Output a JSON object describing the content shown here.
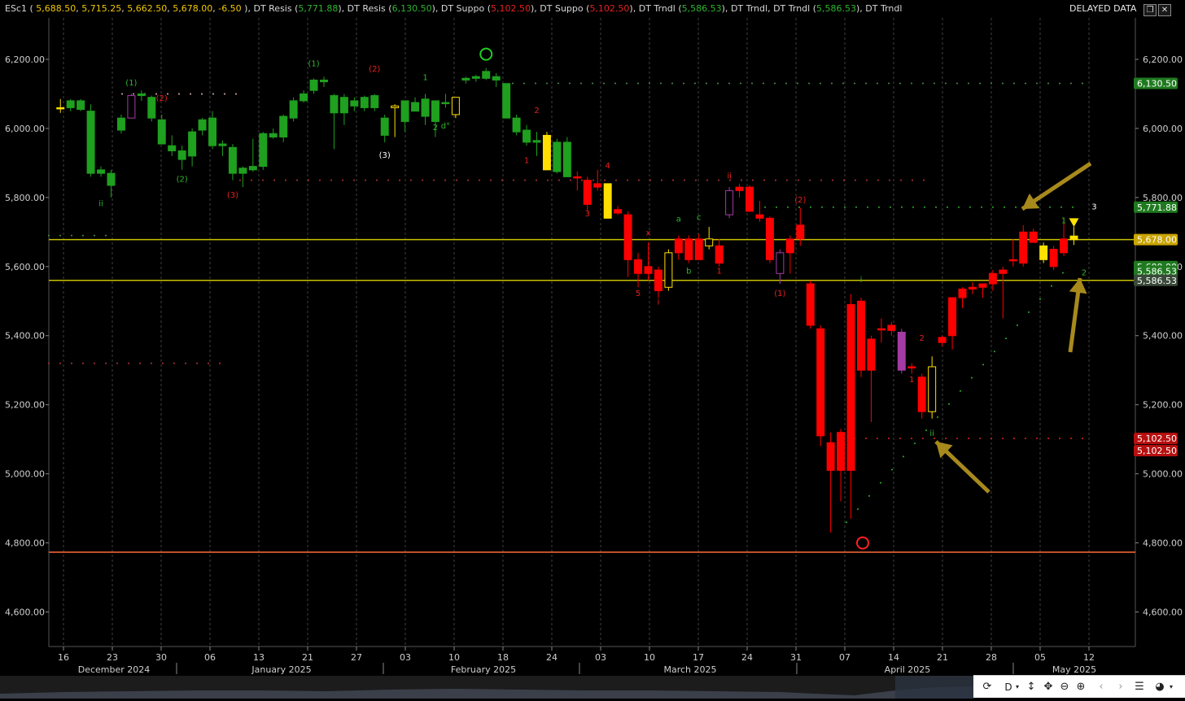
{
  "legend": {
    "symbol": "ESc1",
    "ohlc": [
      "5,688.50",
      "5,715.25",
      "5,662.50",
      "5,678.00",
      "-6.50"
    ],
    "indicators": [
      {
        "name": "DT Resis",
        "value": "5,771.88",
        "color": "#2fb52f"
      },
      {
        "name": "DT Resis",
        "value": "6,130.50",
        "color": "#2fb52f"
      },
      {
        "name": "DT Suppo",
        "value": "5,102.50",
        "color": "#e82020"
      },
      {
        "name": "DT Suppo",
        "value": "5,102.50",
        "color": "#e82020"
      },
      {
        "name": "DT Trndl",
        "value": "5,586.53",
        "color": "#2fb52f"
      },
      {
        "name": "DT Trndl",
        "value": "",
        "color": "#2fb52f"
      },
      {
        "name": "DT Trndl",
        "value": "5,586.53",
        "color": "#2fb52f"
      },
      {
        "name": "DT Trndl",
        "value": "",
        "color": "#2fb52f"
      }
    ]
  },
  "status": {
    "delayed": "DELAYED DATA"
  },
  "toolbar": {
    "refresh_icon": "refresh-icon",
    "interval": "D",
    "icons": [
      "move-vertical-icon",
      "pan-icon",
      "zoom-out-icon",
      "zoom-in-icon",
      "chevron-left-icon",
      "chevron-right-icon",
      "list-icon",
      "palette-icon"
    ]
  },
  "chart_data": {
    "type": "candlestick",
    "title": "",
    "ylim": [
      4500,
      6320
    ],
    "y_ticks": [
      {
        "v": 4600,
        "label": "4,600.00"
      },
      {
        "v": 4800,
        "label": "4,800.00"
      },
      {
        "v": 5000,
        "label": "5,000.00"
      },
      {
        "v": 5200,
        "label": "5,200.00"
      },
      {
        "v": 5400,
        "label": "5,400.00"
      },
      {
        "v": 5600,
        "label": "5,600.00"
      },
      {
        "v": 5800,
        "label": "5,800.00"
      },
      {
        "v": 6000,
        "label": "6,000.00"
      },
      {
        "v": 6200,
        "label": "6,200.00"
      }
    ],
    "x_ticks": [
      "16",
      "23",
      "30",
      "06",
      "13",
      "21",
      "27",
      "03",
      "10",
      "18",
      "24",
      "03",
      "10",
      "17",
      "24",
      "31",
      "07",
      "14",
      "21",
      "28",
      "05",
      "12"
    ],
    "months": [
      "December 2024",
      "January 2025",
      "February 2025",
      "March 2025",
      "April 2025",
      "May 2025"
    ],
    "right_labels": [
      {
        "v": 6130.5,
        "label": "6,130.50",
        "color": "#1f7a1f"
      },
      {
        "v": 5771.88,
        "label": "5,771.88",
        "color": "#1f7a1f"
      },
      {
        "v": 5678.0,
        "label": "5,678.00",
        "color": "#c9a400"
      },
      {
        "v": 5600.0,
        "label": "5,600.00",
        "color": "#1f7a1f"
      },
      {
        "v": 5586.53,
        "label": "5,586.53",
        "color": "#1f7a1f"
      },
      {
        "v": 5560.0,
        "label": "5,586.53",
        "color": "#3a4a3a"
      },
      {
        "v": 5102.5,
        "label": "5,102.50",
        "color": "#b81010"
      },
      {
        "v": 5067.0,
        "label": "5,102.50",
        "color": "#b81010"
      }
    ],
    "horizontal_lines": [
      {
        "v": 5678.0,
        "color": "#c8c000"
      },
      {
        "v": 5560.0,
        "color": "#c8c000"
      },
      {
        "v": 4773.0,
        "color": "#ff6a3a"
      }
    ],
    "candles": [
      {
        "o": 6060,
        "h": 6085,
        "l": 6045,
        "c": 6060,
        "col": "#ffe000"
      },
      {
        "o": 6060,
        "h": 6085,
        "l": 6050,
        "c": 6080,
        "col": "#1fa01f"
      },
      {
        "o": 6080,
        "h": 6085,
        "l": 6050,
        "c": 6055,
        "col": "#1fa01f"
      },
      {
        "o": 6050,
        "h": 6070,
        "l": 5860,
        "c": 5870,
        "col": "#1fa01f"
      },
      {
        "o": 5880,
        "h": 5890,
        "l": 5860,
        "c": 5870,
        "col": "#1fa01f"
      },
      {
        "o": 5870,
        "h": 5880,
        "l": 5800,
        "c": 5835,
        "col": "#1fa01f"
      },
      {
        "o": 5995,
        "h": 6040,
        "l": 5985,
        "c": 6030,
        "col": "#1fa01f"
      },
      {
        "o": 6030,
        "h": 6100,
        "l": 6030,
        "c": 6095,
        "col": "#a43aa4"
      },
      {
        "o": 6095,
        "h": 6110,
        "l": 6080,
        "c": 6100,
        "col": "#1fa01f"
      },
      {
        "o": 6090,
        "h": 6095,
        "l": 6020,
        "c": 6030,
        "col": "#1fa01f"
      },
      {
        "o": 6025,
        "h": 6040,
        "l": 5970,
        "c": 5955,
        "col": "#1fa01f"
      },
      {
        "o": 5950,
        "h": 5980,
        "l": 5920,
        "c": 5935,
        "col": "#1fa01f"
      },
      {
        "o": 5935,
        "h": 5950,
        "l": 5880,
        "c": 5910,
        "col": "#1fa01f"
      },
      {
        "o": 5920,
        "h": 6000,
        "l": 5890,
        "c": 5990,
        "col": "#1fa01f"
      },
      {
        "o": 5995,
        "h": 6030,
        "l": 5980,
        "c": 6025,
        "col": "#1fa01f"
      },
      {
        "o": 6030,
        "h": 6050,
        "l": 5940,
        "c": 5950,
        "col": "#1fa01f"
      },
      {
        "o": 5950,
        "h": 5965,
        "l": 5920,
        "c": 5955,
        "col": "#1fa01f"
      },
      {
        "o": 5945,
        "h": 5955,
        "l": 5850,
        "c": 5870,
        "col": "#1fa01f"
      },
      {
        "o": 5870,
        "h": 5890,
        "l": 5830,
        "c": 5885,
        "col": "#1fa01f"
      },
      {
        "o": 5880,
        "h": 5970,
        "l": 5875,
        "c": 5890,
        "col": "#1fa01f"
      },
      {
        "o": 5890,
        "h": 5990,
        "l": 5880,
        "c": 5985,
        "col": "#1fa01f"
      },
      {
        "o": 5975,
        "h": 6000,
        "l": 5970,
        "c": 5985,
        "col": "#1fa01f"
      },
      {
        "o": 5975,
        "h": 6040,
        "l": 5960,
        "c": 6035,
        "col": "#1fa01f"
      },
      {
        "o": 6030,
        "h": 6090,
        "l": 6020,
        "c": 6080,
        "col": "#1fa01f"
      },
      {
        "o": 6080,
        "h": 6110,
        "l": 6075,
        "c": 6100,
        "col": "#1fa01f"
      },
      {
        "o": 6110,
        "h": 6145,
        "l": 6100,
        "c": 6140,
        "col": "#1fa01f"
      },
      {
        "o": 6135,
        "h": 6150,
        "l": 6120,
        "c": 6140,
        "col": "#1fa01f"
      },
      {
        "o": 6095,
        "h": 6100,
        "l": 5940,
        "c": 6045,
        "col": "#1fa01f"
      },
      {
        "o": 6045,
        "h": 6100,
        "l": 6010,
        "c": 6090,
        "col": "#1fa01f"
      },
      {
        "o": 6080,
        "h": 6090,
        "l": 6050,
        "c": 6065,
        "col": "#1fa01f"
      },
      {
        "o": 6060,
        "h": 6095,
        "l": 6050,
        "c": 6090,
        "col": "#1fa01f"
      },
      {
        "o": 6060,
        "h": 6100,
        "l": 6050,
        "c": 6095,
        "col": "#1fa01f"
      },
      {
        "o": 6030,
        "h": 6040,
        "l": 5960,
        "c": 5980,
        "col": "#1fa01f"
      },
      {
        "o": 6060,
        "h": 6070,
        "l": 5975,
        "c": 6065,
        "col": "#ffe000"
      },
      {
        "o": 6080,
        "h": 6080,
        "l": 5990,
        "c": 6020,
        "col": "#1fa01f"
      },
      {
        "o": 6050,
        "h": 6090,
        "l": 6050,
        "c": 6075,
        "col": "#1fa01f"
      },
      {
        "o": 6085,
        "h": 6100,
        "l": 6010,
        "c": 6035,
        "col": "#1fa01f"
      },
      {
        "o": 6020,
        "h": 6080,
        "l": 5975,
        "c": 6080,
        "col": "#1fa01f"
      },
      {
        "o": 6075,
        "h": 6100,
        "l": 6060,
        "c": 6075,
        "col": "#1fa01f"
      },
      {
        "o": 6040,
        "h": 6080,
        "l": 6030,
        "c": 6090,
        "col": "#ffe000"
      },
      {
        "o": 6140,
        "h": 6150,
        "l": 6130,
        "c": 6145,
        "col": "#1fa01f"
      },
      {
        "o": 6145,
        "h": 6155,
        "l": 6135,
        "c": 6150,
        "col": "#1fa01f"
      },
      {
        "o": 6165,
        "h": 6175,
        "l": 6140,
        "c": 6145,
        "col": "#1fa01f"
      },
      {
        "o": 6150,
        "h": 6160,
        "l": 6120,
        "c": 6140,
        "col": "#1fa01f"
      },
      {
        "o": 6130,
        "h": 6130,
        "l": 6030,
        "c": 6030,
        "col": "#1fa01f"
      },
      {
        "o": 6030,
        "h": 6040,
        "l": 5980,
        "c": 5990,
        "col": "#1fa01f"
      },
      {
        "o": 5995,
        "h": 6010,
        "l": 5950,
        "c": 5960,
        "col": "#1fa01f"
      },
      {
        "o": 5965,
        "h": 5990,
        "l": 5920,
        "c": 5960,
        "col": "#1fa01f"
      },
      {
        "o": 5980,
        "h": 5990,
        "l": 5880,
        "c": 5880,
        "col": "#ffe000"
      },
      {
        "o": 5960,
        "h": 5970,
        "l": 5870,
        "c": 5875,
        "col": "#1fa01f"
      },
      {
        "o": 5960,
        "h": 5975,
        "l": 5860,
        "c": 5860,
        "col": "#1fa01f"
      },
      {
        "o": 5860,
        "h": 5875,
        "l": 5820,
        "c": 5860,
        "col": "#ff0000"
      },
      {
        "o": 5850,
        "h": 5860,
        "l": 5760,
        "c": 5780,
        "col": "#ff0000"
      },
      {
        "o": 5840,
        "h": 5880,
        "l": 5820,
        "c": 5830,
        "col": "#ff0000"
      },
      {
        "o": 5840,
        "h": 5840,
        "l": 5740,
        "c": 5740,
        "col": "#ffe000"
      },
      {
        "o": 5765,
        "h": 5775,
        "l": 5750,
        "c": 5755,
        "col": "#ff0000"
      },
      {
        "o": 5750,
        "h": 5760,
        "l": 5570,
        "c": 5620,
        "col": "#ff0000"
      },
      {
        "o": 5620,
        "h": 5640,
        "l": 5540,
        "c": 5580,
        "col": "#ff0000"
      },
      {
        "o": 5600,
        "h": 5670,
        "l": 5560,
        "c": 5580,
        "col": "#ff0000"
      },
      {
        "o": 5590,
        "h": 5600,
        "l": 5510,
        "c": 5530,
        "col": "#ff0000"
      },
      {
        "o": 5540,
        "h": 5650,
        "l": 5530,
        "c": 5640,
        "col": "#ffe000"
      },
      {
        "o": 5640,
        "h": 5690,
        "l": 5620,
        "c": 5680,
        "col": "#ff0000"
      },
      {
        "o": 5680,
        "h": 5690,
        "l": 5610,
        "c": 5620,
        "col": "#ff0000"
      },
      {
        "o": 5680,
        "h": 5695,
        "l": 5620,
        "c": 5620,
        "col": "#ff0000"
      },
      {
        "o": 5660,
        "h": 5715,
        "l": 5650,
        "c": 5680,
        "col": "#ffe000"
      },
      {
        "o": 5660,
        "h": 5680,
        "l": 5600,
        "c": 5610,
        "col": "#ff0000"
      },
      {
        "o": 5750,
        "h": 5830,
        "l": 5740,
        "c": 5820,
        "col": "#a43aa4"
      },
      {
        "o": 5820,
        "h": 5840,
        "l": 5800,
        "c": 5830,
        "col": "#ff0000"
      },
      {
        "o": 5830,
        "h": 5835,
        "l": 5760,
        "c": 5760,
        "col": "#ff0000"
      },
      {
        "o": 5750,
        "h": 5790,
        "l": 5730,
        "c": 5740,
        "col": "#ff0000"
      },
      {
        "o": 5740,
        "h": 5745,
        "l": 5610,
        "c": 5620,
        "col": "#ff0000"
      },
      {
        "o": 5580,
        "h": 5650,
        "l": 5550,
        "c": 5640,
        "col": "#a43aa4"
      },
      {
        "o": 5640,
        "h": 5690,
        "l": 5580,
        "c": 5680,
        "col": "#ff0000"
      },
      {
        "o": 5680,
        "h": 5770,
        "l": 5660,
        "c": 5720,
        "col": "#ff0000"
      },
      {
        "o": 5550,
        "h": 5560,
        "l": 5420,
        "c": 5430,
        "col": "#ff0000"
      },
      {
        "o": 5420,
        "h": 5430,
        "l": 5080,
        "c": 5110,
        "col": "#ff0000"
      },
      {
        "o": 5090,
        "h": 5120,
        "l": 4830,
        "c": 5010,
        "col": "#ff0000"
      },
      {
        "o": 5010,
        "h": 5130,
        "l": 4920,
        "c": 5120,
        "col": "#ff0000"
      },
      {
        "o": 5010,
        "h": 5520,
        "l": 4870,
        "c": 5490,
        "col": "#ff0000"
      },
      {
        "o": 5500,
        "h": 5510,
        "l": 5280,
        "c": 5300,
        "col": "#ff0000"
      },
      {
        "o": 5300,
        "h": 5400,
        "l": 5150,
        "c": 5390,
        "col": "#ff0000"
      },
      {
        "o": 5420,
        "h": 5450,
        "l": 5380,
        "c": 5420,
        "col": "#ff0000"
      },
      {
        "o": 5430,
        "h": 5440,
        "l": 5400,
        "c": 5415,
        "col": "#ff0000"
      },
      {
        "o": 5410,
        "h": 5420,
        "l": 5290,
        "c": 5300,
        "col": "#a43aa4"
      },
      {
        "o": 5310,
        "h": 5320,
        "l": 5290,
        "c": 5310,
        "col": "#ff0000"
      },
      {
        "o": 5280,
        "h": 5290,
        "l": 5160,
        "c": 5180,
        "col": "#ff0000"
      },
      {
        "o": 5180,
        "h": 5340,
        "l": 5160,
        "c": 5310,
        "col": "#ffe000"
      },
      {
        "o": 5380,
        "h": 5400,
        "l": 5370,
        "c": 5395,
        "col": "#ff0000"
      },
      {
        "o": 5400,
        "h": 5470,
        "l": 5360,
        "c": 5510,
        "col": "#ff0000"
      },
      {
        "o": 5510,
        "h": 5540,
        "l": 5480,
        "c": 5535,
        "col": "#ff0000"
      },
      {
        "o": 5535,
        "h": 5555,
        "l": 5520,
        "c": 5540,
        "col": "#ff0000"
      },
      {
        "o": 5540,
        "h": 5550,
        "l": 5510,
        "c": 5550,
        "col": "#ff0000"
      },
      {
        "o": 5550,
        "h": 5590,
        "l": 5530,
        "c": 5580,
        "col": "#ff0000"
      },
      {
        "o": 5580,
        "h": 5600,
        "l": 5450,
        "c": 5590,
        "col": "#ff0000"
      },
      {
        "o": 5620,
        "h": 5680,
        "l": 5600,
        "c": 5620,
        "col": "#ff0000"
      },
      {
        "o": 5610,
        "h": 5720,
        "l": 5600,
        "c": 5700,
        "col": "#ff0000"
      },
      {
        "o": 5700,
        "h": 5710,
        "l": 5670,
        "c": 5670,
        "col": "#ff0000"
      },
      {
        "o": 5660,
        "h": 5670,
        "l": 5610,
        "c": 5620,
        "col": "#ffe000"
      },
      {
        "o": 5600,
        "h": 5660,
        "l": 5590,
        "c": 5650,
        "col": "#ff0000"
      },
      {
        "o": 5640,
        "h": 5740,
        "l": 5630,
        "c": 5680,
        "col": "#ff0000"
      },
      {
        "o": 5688.5,
        "h": 5715.25,
        "l": 5662.5,
        "c": 5678,
        "col": "#ffe000"
      }
    ],
    "markers": [
      {
        "text": "(1)",
        "i": 7,
        "v": 6125,
        "color": "#2fb52f"
      },
      {
        "text": "(2)",
        "i": 10,
        "v": 6080,
        "color": "#e82020"
      },
      {
        "text": "ii",
        "i": 4,
        "v": 5775,
        "color": "#2fb52f"
      },
      {
        "text": "(2)",
        "i": 12,
        "v": 5845,
        "color": "#2fb52f"
      },
      {
        "text": "(3)",
        "i": 17,
        "v": 5800,
        "color": "#e82020"
      },
      {
        "text": "(1)",
        "i": 25,
        "v": 6180,
        "color": "#2fb52f"
      },
      {
        "text": "(2)",
        "i": 31,
        "v": 6165,
        "color": "#e82020"
      },
      {
        "text": "(3)",
        "i": 32,
        "v": 5915,
        "color": "#ffffff"
      },
      {
        "text": "1",
        "i": 36,
        "v": 6140,
        "color": "#2fb52f"
      },
      {
        "text": "2",
        "i": 37,
        "v": 5995,
        "color": "#2fb52f"
      },
      {
        "text": "d°",
        "i": 38,
        "v": 6000,
        "color": "#2fb52f"
      },
      {
        "text": "2",
        "i": 47,
        "v": 6045,
        "color": "#e82020"
      },
      {
        "text": "1",
        "i": 46,
        "v": 5900,
        "color": "#e82020"
      },
      {
        "text": "4",
        "i": 54,
        "v": 5885,
        "color": "#e82020"
      },
      {
        "text": "3",
        "i": 52,
        "v": 5745,
        "color": "#e82020"
      },
      {
        "text": "x",
        "i": 58,
        "v": 5690,
        "color": "#e82020"
      },
      {
        "text": "5",
        "i": 57,
        "v": 5515,
        "color": "#e82020"
      },
      {
        "text": "i",
        "i": 59,
        "v": 5490,
        "color": "#e82020"
      },
      {
        "text": "a",
        "i": 61,
        "v": 5730,
        "color": "#2fb52f"
      },
      {
        "text": "b",
        "i": 62,
        "v": 5580,
        "color": "#2fb52f"
      },
      {
        "text": "c",
        "i": 63,
        "v": 5735,
        "color": "#2fb52f"
      },
      {
        "text": "1",
        "i": 65,
        "v": 5580,
        "color": "#e82020"
      },
      {
        "text": "ii",
        "i": 66,
        "v": 5855,
        "color": "#e82020"
      },
      {
        "text": "(2)",
        "i": 73,
        "v": 5785,
        "color": "#e82020"
      },
      {
        "text": "(1)",
        "i": 71,
        "v": 5515,
        "color": "#e82020"
      },
      {
        "text": "i",
        "i": 79,
        "v": 5555,
        "color": "#2fb52f"
      },
      {
        "text": "2",
        "i": 85,
        "v": 5385,
        "color": "#e82020"
      },
      {
        "text": "1",
        "i": 84,
        "v": 5265,
        "color": "#e82020"
      },
      {
        "text": "ii",
        "i": 86,
        "v": 5110,
        "color": "#2fb52f"
      },
      {
        "text": "1",
        "i": 99,
        "v": 5725,
        "color": "#2fb52f"
      },
      {
        "text": "2",
        "i": 101,
        "v": 5575,
        "color": "#2fb52f"
      },
      {
        "text": "3",
        "i": 102,
        "v": 5765,
        "color": "#ffffff"
      }
    ]
  }
}
